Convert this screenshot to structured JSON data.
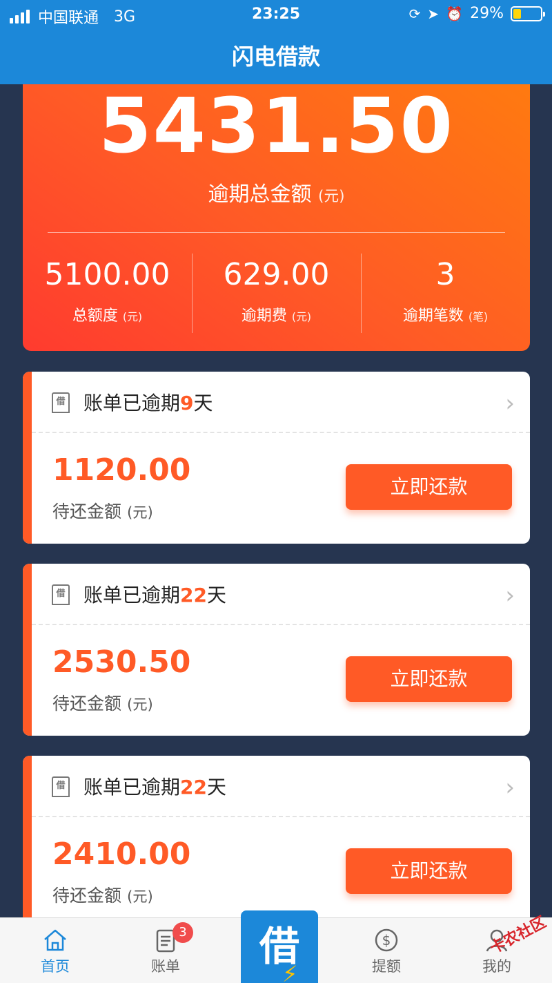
{
  "status_bar": {
    "carrier": "中国联通",
    "network": "3G",
    "time": "23:25",
    "battery": "29%",
    "battery_level": 0.29
  },
  "nav": {
    "title": "闪电借款"
  },
  "summary": {
    "total_amount": "5431.50",
    "total_label": "逾期总金额",
    "total_unit": "(元)",
    "stats": [
      {
        "value": "5100.00",
        "label": "总额度",
        "unit": "(元)"
      },
      {
        "value": "629.00",
        "label": "逾期费",
        "unit": "(元)"
      },
      {
        "value": "3",
        "label": "逾期笔数",
        "unit": "(笔)"
      }
    ]
  },
  "bills": [
    {
      "title_prefix": "账单已逾期",
      "days": "9",
      "title_suffix": "天",
      "amount": "1120.00",
      "amount_label": "待还金额",
      "unit": "(元)",
      "button": "立即还款",
      "icon_text": "借"
    },
    {
      "title_prefix": "账单已逾期",
      "days": "22",
      "title_suffix": "天",
      "amount": "2530.50",
      "amount_label": "待还金额",
      "unit": "(元)",
      "button": "立即还款",
      "icon_text": "借"
    },
    {
      "title_prefix": "账单已逾期",
      "days": "22",
      "title_suffix": "天",
      "amount": "2410.00",
      "amount_label": "待还金额",
      "unit": "(元)",
      "button": "立即还款",
      "icon_text": "借"
    }
  ],
  "tabbar": {
    "home": "首页",
    "bills": "账单",
    "bills_badge": "3",
    "borrow": "借",
    "limit": "提额",
    "mine": "我的"
  },
  "watermark": "卡农社区",
  "colors": {
    "brand_blue": "#1c88d9",
    "accent_orange": "#ff5a26",
    "background": "#263550"
  }
}
